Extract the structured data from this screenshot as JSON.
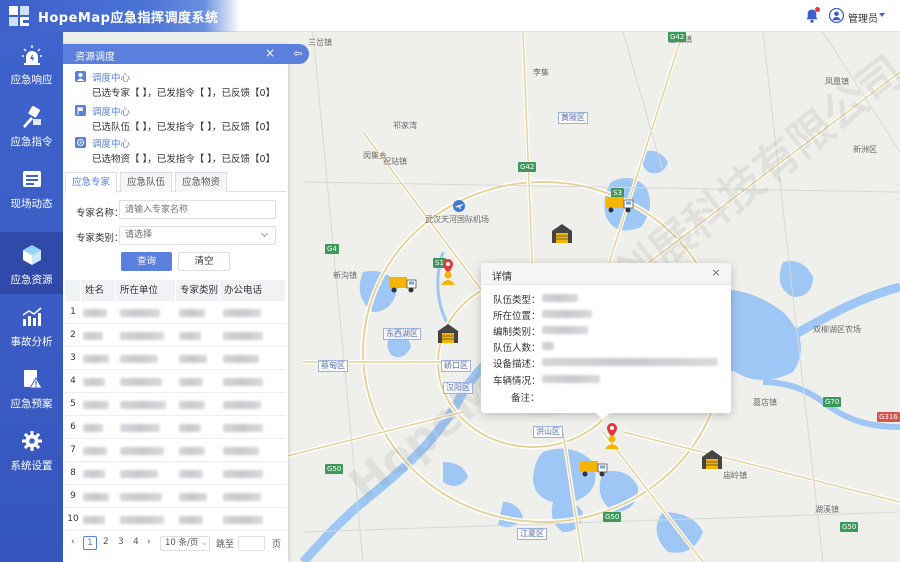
{
  "app": {
    "title": "HopeMap应急指挥调度系统"
  },
  "header": {
    "user_name": "管理员"
  },
  "sidebar": {
    "items": [
      {
        "label": "应急响应",
        "icon": "alarm-light-icon"
      },
      {
        "label": "应急指令",
        "icon": "command-icon"
      },
      {
        "label": "现场动态",
        "icon": "scene-icon"
      },
      {
        "label": "应急资源",
        "icon": "resource-box-icon",
        "active": true
      },
      {
        "label": "事故分析",
        "icon": "chart-icon"
      },
      {
        "label": "应急预案",
        "icon": "warning-plan-icon"
      },
      {
        "label": "系统设置",
        "icon": "gear-icon"
      }
    ]
  },
  "panel": {
    "title": "资源调度",
    "close": "×",
    "messages": [
      {
        "title": "调度中心",
        "text": "已选专家【 】，已发指令【 】，已反馈【0】"
      },
      {
        "title": "调度中心",
        "text": "已选队伍【 】，已发指令【 】，已反馈【0】"
      },
      {
        "title": "调度中心",
        "text": "已选物资【 】，已发指令【 】，已反馈【0】"
      }
    ],
    "tabs": [
      "应急专家",
      "应急队伍",
      "应急物资"
    ],
    "form": {
      "name_label": "专家名称：",
      "name_placeholder": "请输入专家名称",
      "type_label": "专家类别：",
      "type_value": "请选择",
      "query_button": "查询",
      "clear_button": "清空"
    },
    "table": {
      "headers": [
        "姓名",
        "所在单位",
        "专家类别",
        "办公电话"
      ],
      "row_numbers": [
        "1",
        "2",
        "3",
        "4",
        "5",
        "6",
        "7",
        "8",
        "9",
        "10"
      ]
    },
    "pager": {
      "pages": [
        "1",
        "2",
        "3",
        "4"
      ],
      "page_size": "10 条/页",
      "goto_label": "跳至",
      "page_unit": "页"
    }
  },
  "popup": {
    "title": "详情",
    "close": "×",
    "fields": [
      "队伍类型：",
      "所在位置：",
      "编制类别：",
      "队伍人数：",
      "设备描述：",
      "车辆情况：",
      "备注："
    ]
  },
  "map": {
    "places": [
      {
        "name": "三岔镇"
      },
      {
        "name": "伍湖镇"
      },
      {
        "name": "李集"
      },
      {
        "name": "祁家湾"
      },
      {
        "name": "祝站镇"
      },
      {
        "name": "闵集乡"
      },
      {
        "name": "新沟镇"
      },
      {
        "name": "新洲区"
      },
      {
        "name": "凤凰镇"
      },
      {
        "name": "武汉天河国际机场"
      },
      {
        "name": "双柳湖区农场"
      },
      {
        "name": "葛店镇"
      },
      {
        "name": "庙岭镇"
      },
      {
        "name": "湖溪镇"
      }
    ],
    "districts": [
      {
        "name": "黄陂区"
      },
      {
        "name": "东西湖区"
      },
      {
        "name": "硚口区"
      },
      {
        "name": "汉阳区"
      },
      {
        "name": "洪山区"
      },
      {
        "name": "江夏区"
      },
      {
        "name": "蔡甸区"
      }
    ],
    "roads": [
      "G42",
      "G42",
      "S3",
      "G4",
      "S1",
      "G50",
      "G50",
      "G316",
      "G70",
      "G50"
    ],
    "watermark": "HopeMap 宏图创展科技有限公司"
  }
}
